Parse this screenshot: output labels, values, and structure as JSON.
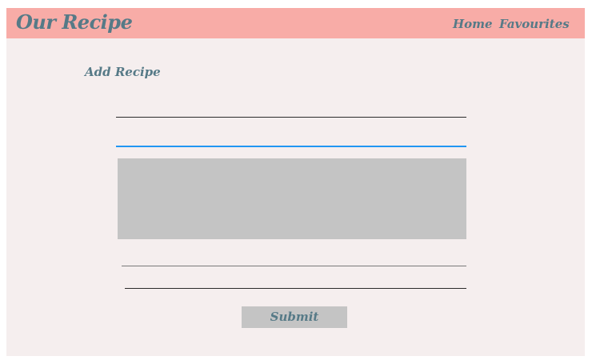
{
  "navbar": {
    "brand": "Our Recipe",
    "links": [
      {
        "label": "Home"
      },
      {
        "label": "Favourites"
      }
    ]
  },
  "page": {
    "heading": "Add Recipe"
  },
  "form": {
    "fields": [
      {
        "value": "",
        "placeholder": ""
      },
      {
        "value": "",
        "placeholder": ""
      },
      {
        "value": "",
        "placeholder": ""
      },
      {
        "value": "",
        "placeholder": ""
      }
    ],
    "textarea": {
      "value": "",
      "placeholder": ""
    },
    "submit_label": "Submit"
  },
  "colors": {
    "navbar_bg": "#f8aca7",
    "page_bg": "#f5eeee",
    "text_accent": "#567a87",
    "focus_underline": "#2196f3",
    "field_fill": "#c4c4c4"
  }
}
